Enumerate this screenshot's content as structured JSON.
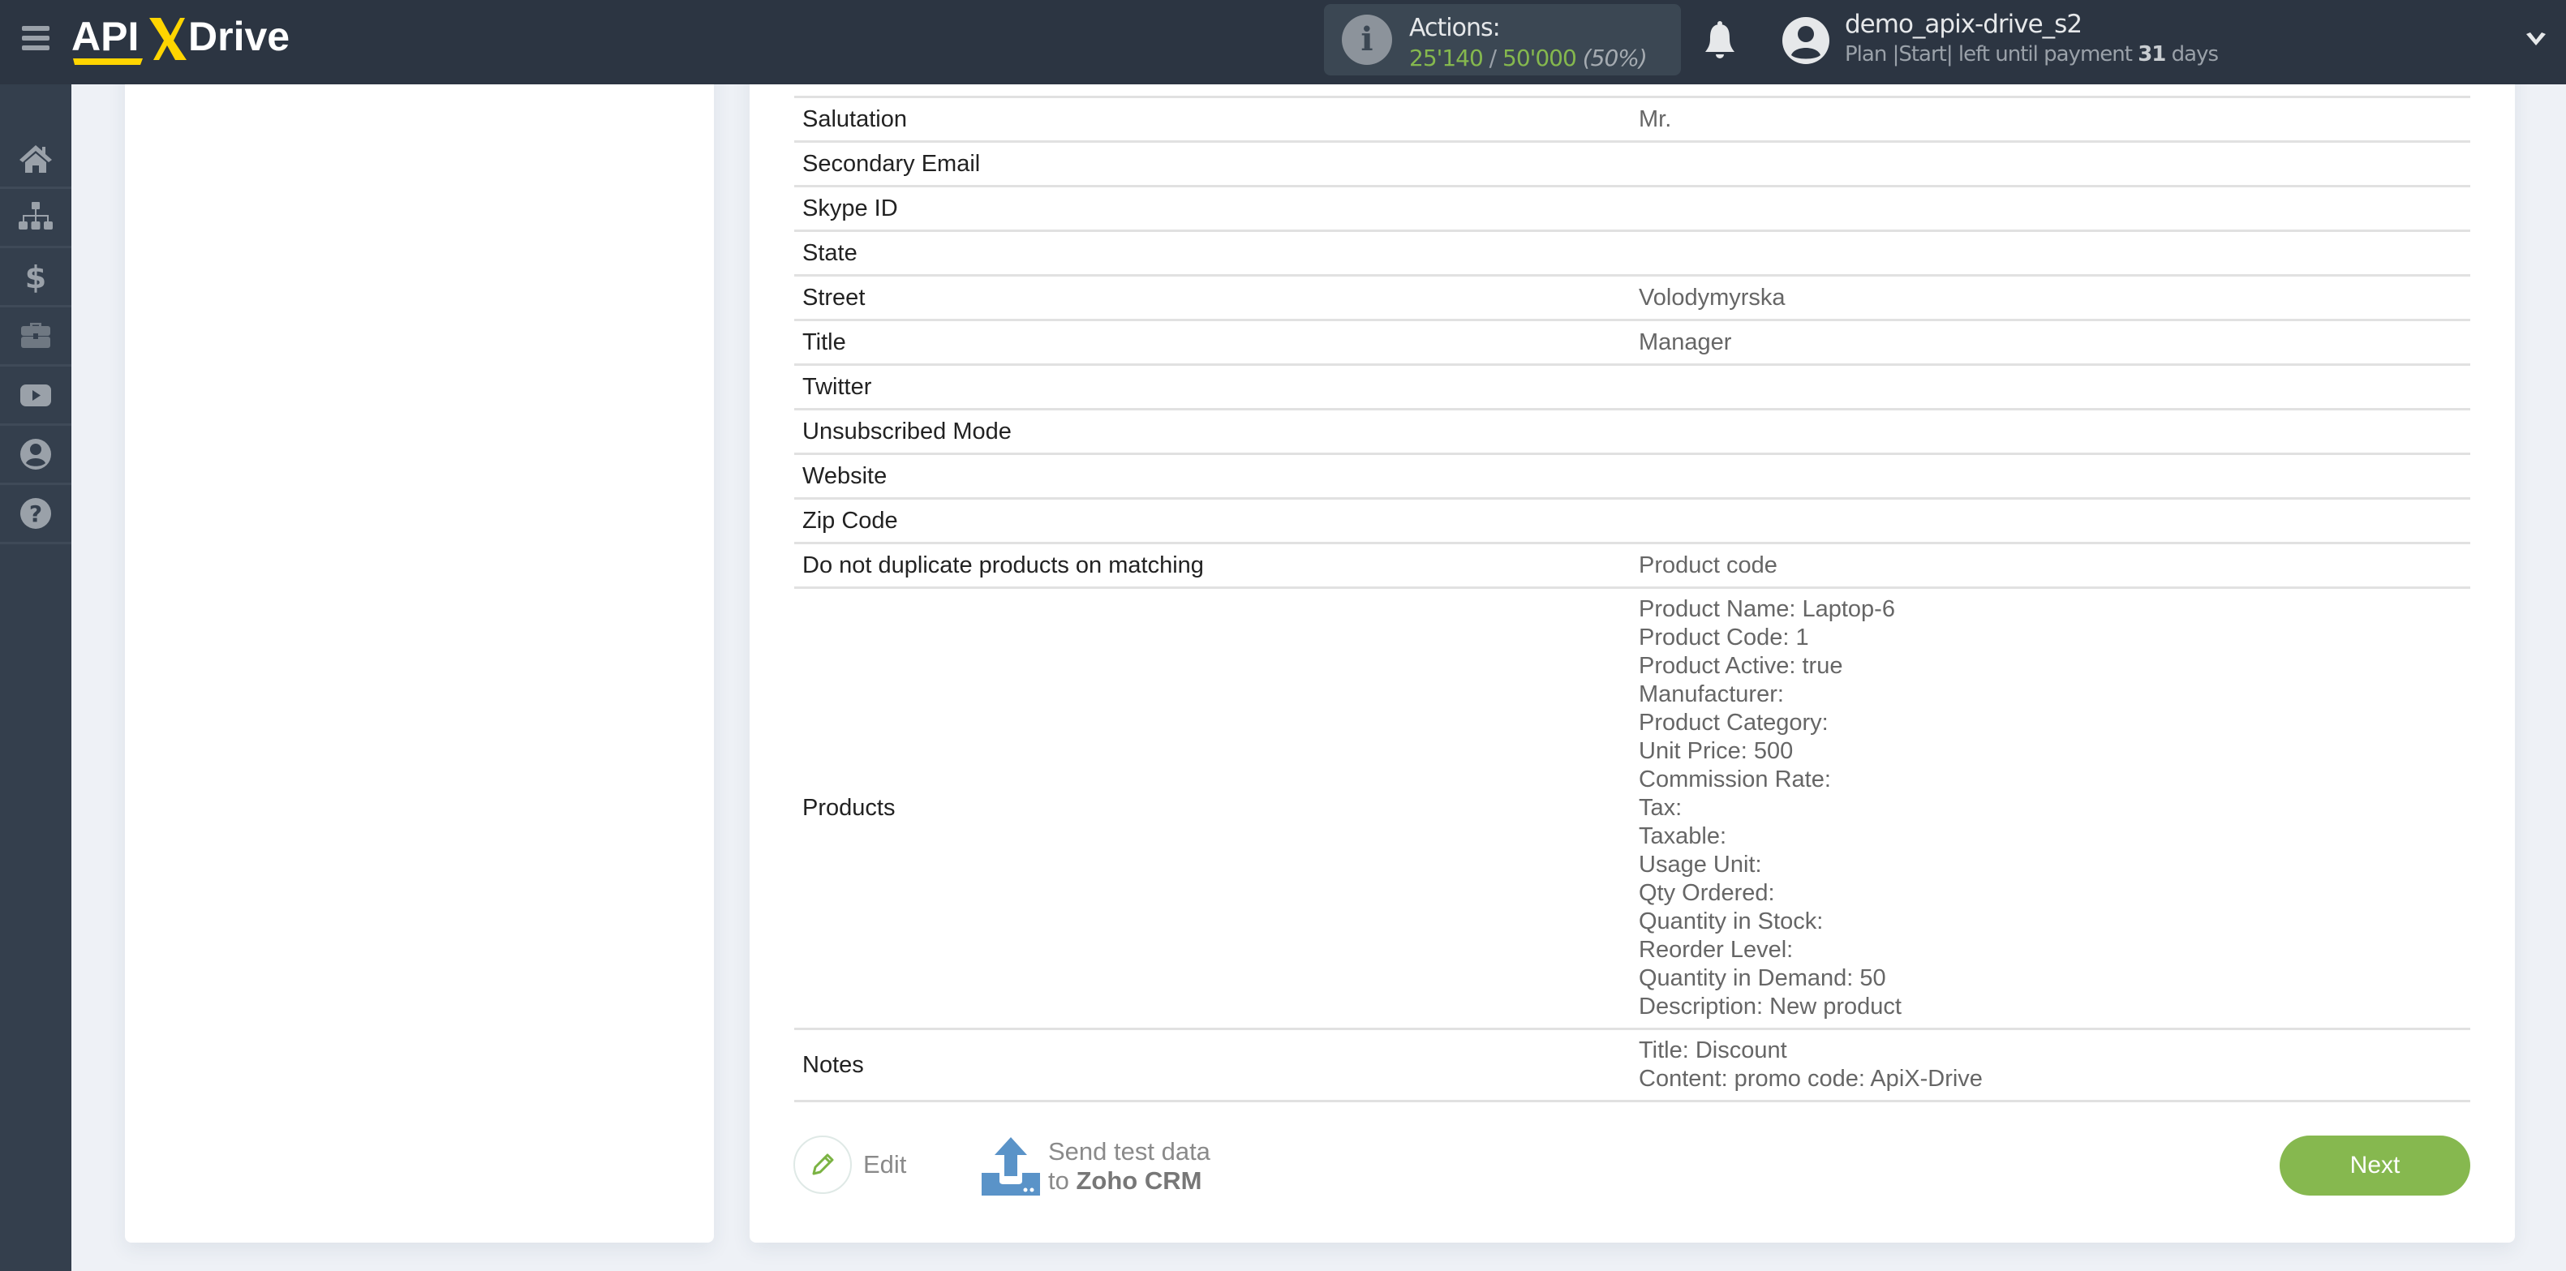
{
  "header": {
    "logo_text": "APIXDrive",
    "actions_label": "Actions:",
    "actions_used": "25'140",
    "actions_separator": " / ",
    "actions_total": "50'000",
    "actions_percent": "(50%)",
    "username": "demo_apix-drive_s2",
    "plan_prefix": "Plan |Start| left until payment ",
    "plan_days": "31",
    "plan_suffix": " days"
  },
  "sidebar": {
    "items": [
      {
        "name": "home",
        "icon": "home-icon"
      },
      {
        "name": "connections",
        "icon": "sitemap-icon"
      },
      {
        "name": "billing",
        "icon": "dollar-icon"
      },
      {
        "name": "services",
        "icon": "briefcase-icon"
      },
      {
        "name": "video",
        "icon": "youtube-icon"
      },
      {
        "name": "account",
        "icon": "user-icon"
      },
      {
        "name": "help",
        "icon": "help-icon"
      }
    ]
  },
  "table": {
    "rows": [
      {
        "label": "Salutation",
        "value": "Mr."
      },
      {
        "label": "Secondary Email",
        "value": ""
      },
      {
        "label": "Skype ID",
        "value": ""
      },
      {
        "label": "State",
        "value": ""
      },
      {
        "label": "Street",
        "value": "Volodymyrska"
      },
      {
        "label": "Title",
        "value": "Manager"
      },
      {
        "label": "Twitter",
        "value": ""
      },
      {
        "label": "Unsubscribed Mode",
        "value": ""
      },
      {
        "label": "Website",
        "value": ""
      },
      {
        "label": "Zip Code",
        "value": ""
      },
      {
        "label": "Do not duplicate products on matching",
        "value": "Product code"
      }
    ],
    "products": {
      "label": "Products",
      "lines": [
        "Product Name: Laptop-6",
        "Product Code: 1",
        "Product Active: true",
        "Manufacturer:",
        "Product Category:",
        "Unit Price: 500",
        "Commission Rate:",
        "Tax:",
        "Taxable:",
        "Usage Unit:",
        "Qty Ordered:",
        "Quantity in Stock:",
        "Reorder Level:",
        "Quantity in Demand: 50",
        "Description: New product"
      ]
    },
    "notes": {
      "label": "Notes",
      "lines": [
        "Title: Discount",
        "Content: promo code: ApiX-Drive"
      ]
    }
  },
  "actions": {
    "edit_label": "Edit",
    "send_line1": "Send test data",
    "send_line2_prefix": "to ",
    "send_target": "Zoho CRM",
    "next_label": "Next"
  },
  "colors": {
    "header_bg": "#2c3542",
    "sidebar_bg": "#343f4d",
    "accent_green": "#86b84f",
    "logo_yellow": "#ffd500",
    "upload_blue": "#5a93c8"
  }
}
